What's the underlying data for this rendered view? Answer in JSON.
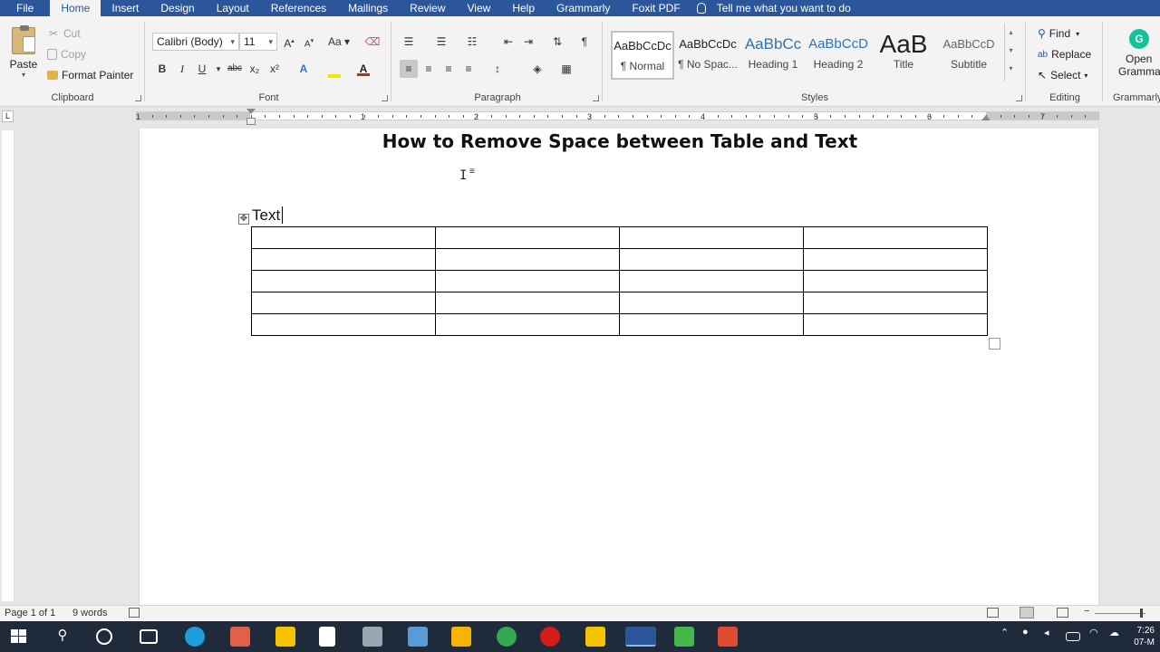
{
  "menu": {
    "tabs": [
      "File",
      "Home",
      "Insert",
      "Design",
      "Layout",
      "References",
      "Mailings",
      "Review",
      "View",
      "Help",
      "Grammarly",
      "Foxit PDF"
    ],
    "active": "Home",
    "tell_me": "Tell me what you want to do"
  },
  "clipboard": {
    "paste": "Paste",
    "cut": "Cut",
    "copy": "Copy",
    "format_painter": "Format Painter",
    "label": "Clipboard"
  },
  "font": {
    "family": "Calibri (Body)",
    "size": "11",
    "label": "Font",
    "case_button": "Aa",
    "bold": "B",
    "italic": "I",
    "underline": "U",
    "strike": "abc",
    "subscript": "x₂",
    "superscript": "x²"
  },
  "paragraph": {
    "label": "Paragraph"
  },
  "styles": {
    "items": [
      {
        "preview": "AaBbCcDc",
        "name": "¶ Normal"
      },
      {
        "preview": "AaBbCcDc",
        "name": "¶ No Spac..."
      },
      {
        "preview": "AaBbCc",
        "name": "Heading 1"
      },
      {
        "preview": "AaBbCcD",
        "name": "Heading 2"
      },
      {
        "preview": "AaB",
        "name": "Title"
      },
      {
        "preview": "AaBbCcD",
        "name": "Subtitle"
      }
    ],
    "label": "Styles"
  },
  "editing": {
    "find": "Find",
    "replace": "Replace",
    "select": "Select",
    "label": "Editing"
  },
  "grammarly": {
    "open": "Open",
    "name": "Grammarly",
    "label": "Grammarly"
  },
  "ruler": {
    "numbers": [
      "1",
      "1",
      "2",
      "3",
      "4",
      "5",
      "6",
      "7"
    ]
  },
  "document": {
    "title": "How to Remove Space between Table and Text",
    "text": "Text",
    "table_rows": 5,
    "table_cols": 4
  },
  "status": {
    "page": "Page 1 of 1",
    "words": "9 words"
  },
  "clock": {
    "time": "7:26",
    "date": "07-M"
  },
  "colors": {
    "menubar": "#2b579a",
    "ribbon": "#f3f3f3",
    "taskbar": "#1f2a3a"
  }
}
